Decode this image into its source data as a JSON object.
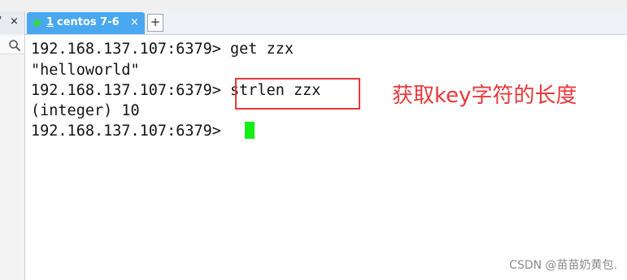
{
  "window": {
    "left_tab_cut": "/",
    "left_tab_close": "×"
  },
  "tabs": [
    {
      "number": "1",
      "label": "centos 7-6",
      "close": "×",
      "status_color": "#36d64a",
      "accent": "#4aa8f0"
    }
  ],
  "add_tab_label": "+",
  "terminal": {
    "lines": [
      "192.168.137.107:6379> get zzx",
      "\"helloworld\"",
      "192.168.137.107:6379> strlen zzx",
      "(integer) 10",
      "192.168.137.107:6379> "
    ],
    "cursor_color": "#13ee13"
  },
  "annotation": {
    "text": "获取key字符的长度",
    "color": "#e8393b"
  },
  "watermark": "CSDN @苗苗奶黄包."
}
